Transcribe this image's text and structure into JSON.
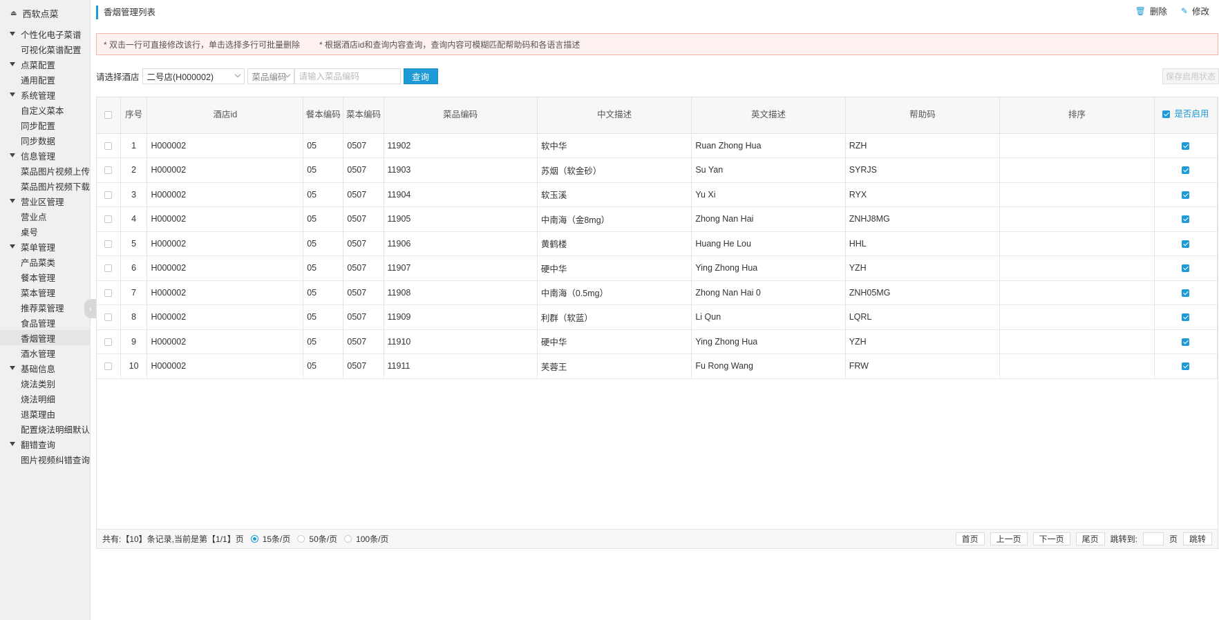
{
  "sidebar": {
    "brand": "西软点菜",
    "groups": [
      {
        "label": "个性化电子菜谱",
        "items": [
          "可视化菜谱配置"
        ]
      },
      {
        "label": "点菜配置",
        "items": [
          "通用配置"
        ]
      },
      {
        "label": "系统管理",
        "items": [
          "自定义菜本",
          "同步配置",
          "同步数据"
        ]
      },
      {
        "label": "信息管理",
        "items": [
          "菜品图片视频上传",
          "菜品图片视频下载"
        ]
      },
      {
        "label": "营业区管理",
        "items": [
          "营业点",
          "桌号"
        ]
      },
      {
        "label": "菜单管理",
        "items": [
          "产品菜类",
          "餐本管理",
          "菜本管理",
          "推荐菜管理",
          "食品管理",
          "香烟管理",
          "酒水管理"
        ]
      },
      {
        "label": "基础信息",
        "items": [
          "烧法类别",
          "烧法明细",
          "退菜理由",
          "配置烧法明细默认信"
        ]
      },
      {
        "label": "翻错查询",
        "items": [
          "图片视频纠错查询"
        ]
      }
    ],
    "active_item": "香烟管理"
  },
  "header": {
    "title": "香烟管理列表",
    "delete_label": "删除",
    "edit_label": "修改"
  },
  "notice": {
    "line1": "* 双击一行可直接修改该行，单击选择多行可批量删除",
    "line2": "* 根据酒店id和查询内容查询，查询内容可模糊匹配帮助码和各语言描述"
  },
  "filter": {
    "hotel_label": "请选择酒店",
    "hotel_value": "二号店(H000002)",
    "field_select": "菜品编码",
    "input_placeholder": "请输入菜品编码",
    "query_label": "查询",
    "save_label": "保存启用状态"
  },
  "table": {
    "headers": {
      "index": "序号",
      "hotel_id": "酒店id",
      "menu_code": "餐本编码",
      "book_code": "菜本编码",
      "dish_code": "菜品编码",
      "cn_desc": "中文描述",
      "en_desc": "英文描述",
      "help_code": "帮助码",
      "sort": "排序",
      "enabled": "是否启用"
    },
    "rows": [
      {
        "index": "1",
        "hotel_id": "H000002",
        "menu_code": "05",
        "book_code": "0507",
        "dish_code": "11902",
        "cn_desc": "软中华",
        "en_desc": "Ruan Zhong Hua",
        "help_code": "RZH",
        "sort": ""
      },
      {
        "index": "2",
        "hotel_id": "H000002",
        "menu_code": "05",
        "book_code": "0507",
        "dish_code": "11903",
        "cn_desc": "苏烟（软金砂）",
        "en_desc": "Su Yan",
        "help_code": "SYRJS",
        "sort": ""
      },
      {
        "index": "3",
        "hotel_id": "H000002",
        "menu_code": "05",
        "book_code": "0507",
        "dish_code": "11904",
        "cn_desc": "软玉溪",
        "en_desc": "Yu Xi",
        "help_code": "RYX",
        "sort": ""
      },
      {
        "index": "4",
        "hotel_id": "H000002",
        "menu_code": "05",
        "book_code": "0507",
        "dish_code": "11905",
        "cn_desc": "中南海（金8mg）",
        "en_desc": "Zhong Nan Hai",
        "help_code": "ZNHJ8MG",
        "sort": ""
      },
      {
        "index": "5",
        "hotel_id": "H000002",
        "menu_code": "05",
        "book_code": "0507",
        "dish_code": "11906",
        "cn_desc": "黄鹤楼",
        "en_desc": "Huang He Lou",
        "help_code": "HHL",
        "sort": ""
      },
      {
        "index": "6",
        "hotel_id": "H000002",
        "menu_code": "05",
        "book_code": "0507",
        "dish_code": "11907",
        "cn_desc": "硬中华",
        "en_desc": "Ying Zhong Hua",
        "help_code": "YZH",
        "sort": ""
      },
      {
        "index": "7",
        "hotel_id": "H000002",
        "menu_code": "05",
        "book_code": "0507",
        "dish_code": "11908",
        "cn_desc": "中南海（0.5mg）",
        "en_desc": "Zhong Nan Hai 0",
        "help_code": "ZNH05MG",
        "sort": ""
      },
      {
        "index": "8",
        "hotel_id": "H000002",
        "menu_code": "05",
        "book_code": "0507",
        "dish_code": "11909",
        "cn_desc": "利群（软蓝）",
        "en_desc": "Li Qun",
        "help_code": "LQRL",
        "sort": ""
      },
      {
        "index": "9",
        "hotel_id": "H000002",
        "menu_code": "05",
        "book_code": "0507",
        "dish_code": "11910",
        "cn_desc": "硬中华",
        "en_desc": "Ying Zhong Hua",
        "help_code": "YZH",
        "sort": ""
      },
      {
        "index": "10",
        "hotel_id": "H000002",
        "menu_code": "05",
        "book_code": "0507",
        "dish_code": "11911",
        "cn_desc": "芙蓉王",
        "en_desc": "Fu Rong Wang",
        "help_code": "FRW",
        "sort": ""
      }
    ]
  },
  "pager": {
    "summary": "共有:【10】条记录,当前是第【1/1】页",
    "size_15": "15条/页",
    "size_50": "50条/页",
    "size_100": "100条/页",
    "first": "首页",
    "prev": "上一页",
    "next": "下一页",
    "last": "尾页",
    "jump_label": "跳转到:",
    "page_unit": "页",
    "jump_btn": "跳转"
  },
  "colors": {
    "accent": "#1e9ad6",
    "notice_bg": "#fdf2ef",
    "notice_border": "#f3b6a8"
  }
}
